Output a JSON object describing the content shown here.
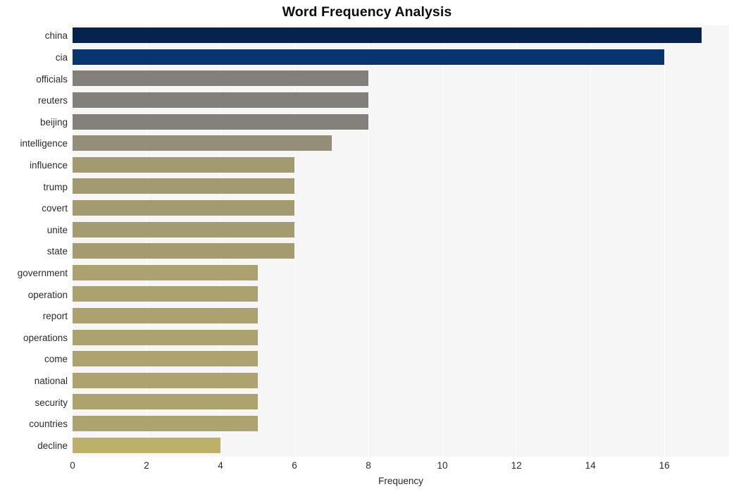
{
  "chart_data": {
    "type": "bar",
    "orientation": "horizontal",
    "title": "Word Frequency Analysis",
    "xlabel": "Frequency",
    "ylabel": "",
    "categories": [
      "china",
      "cia",
      "officials",
      "reuters",
      "beijing",
      "intelligence",
      "influence",
      "trump",
      "covert",
      "unite",
      "state",
      "government",
      "operation",
      "report",
      "operations",
      "come",
      "national",
      "security",
      "countries",
      "decline"
    ],
    "values": [
      17,
      16,
      8,
      8,
      8,
      7,
      6,
      6,
      6,
      6,
      6,
      5,
      5,
      5,
      5,
      5,
      5,
      5,
      5,
      4
    ],
    "bar_colors": [
      "#06234b",
      "#07356f",
      "#83807c",
      "#83807c",
      "#84817d",
      "#948d78",
      "#a39a71",
      "#a39a71",
      "#a39a71",
      "#a49b71",
      "#a49b71",
      "#aca26f",
      "#aca26f",
      "#aca26f",
      "#aca26f",
      "#ada36f",
      "#ada36f",
      "#ada36f",
      "#ada36f",
      "#bdb06a"
    ],
    "xlim": [
      0,
      17.75
    ],
    "xticks": [
      0,
      2,
      4,
      6,
      8,
      10,
      12,
      14,
      16
    ],
    "xtick_labels": [
      "0",
      "2",
      "4",
      "6",
      "8",
      "10",
      "12",
      "14",
      "16"
    ],
    "grid": "vertical",
    "legend": "none",
    "plot_background": "#f6f6f7",
    "figure_background": "#ffffff"
  }
}
